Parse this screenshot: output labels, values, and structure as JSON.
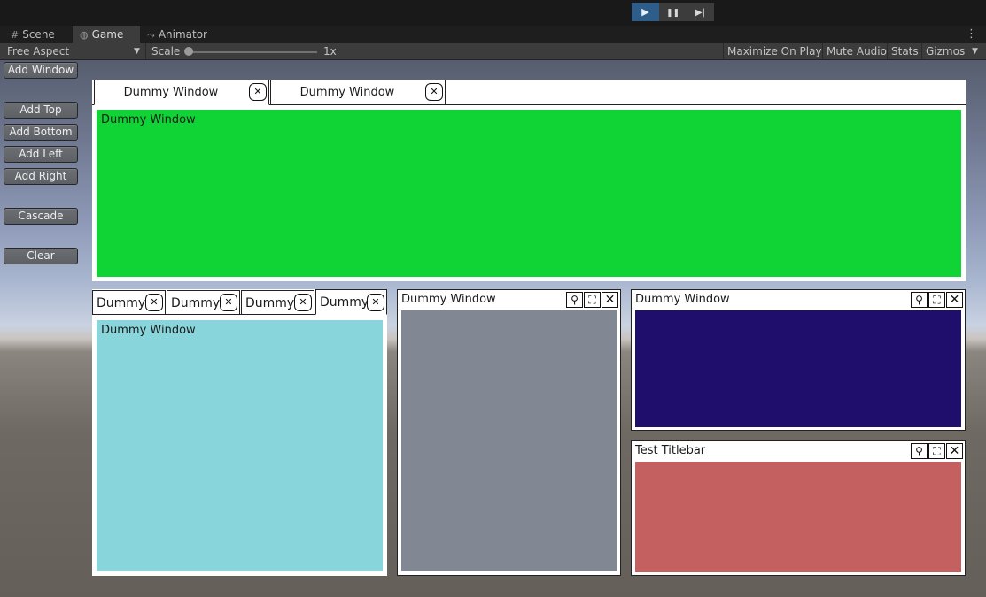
{
  "playbar": {
    "play_icon": "play-icon",
    "pause_icon": "pause-icon",
    "step_icon": "step-icon",
    "play_glyph": "▶",
    "pause_glyph": "❚❚",
    "step_glyph": "▶|"
  },
  "tabs": [
    {
      "label": "Scene",
      "icon": "grid-icon",
      "glyph": "#"
    },
    {
      "label": "Game",
      "icon": "gamepad-icon",
      "glyph": "◍"
    },
    {
      "label": "Animator",
      "icon": "animator-icon",
      "glyph": "⤳"
    }
  ],
  "toolbar": {
    "aspect": "Free Aspect",
    "scale_label": "Scale",
    "scale_value": "1x",
    "maximize": "Maximize On Play",
    "mute": "Mute Audio",
    "stats": "Stats",
    "gizmos": "Gizmos"
  },
  "buttons": {
    "add_window": "Add Window",
    "add_top": "Add Top",
    "add_bottom": "Add Bottom",
    "add_left": "Add Left",
    "add_right": "Add Right",
    "cascade": "Cascade",
    "clear": "Clear"
  },
  "top_dock": {
    "tabs": [
      "Dummy Window",
      "Dummy Window"
    ],
    "content_title": "Dummy Window",
    "content_color": "#10d436"
  },
  "left_dock": {
    "tabs": [
      "Dummy",
      "Dummy",
      "Dummy",
      "Dummy"
    ],
    "content_title": "Dummy Window",
    "content_color": "#88d5dc"
  },
  "middle_window": {
    "title": "Dummy Window",
    "content_color": "#818894"
  },
  "right_top_window": {
    "title": "Dummy Window",
    "content_color": "#1f0e6b"
  },
  "right_bottom_window": {
    "title": "Test Titlebar",
    "content_color": "#c46060"
  },
  "window_icons": {
    "pin_glyph": "⚲",
    "maximize_glyph": "⛶",
    "close_glyph": "✕",
    "tab_close_glyph": "✕"
  }
}
